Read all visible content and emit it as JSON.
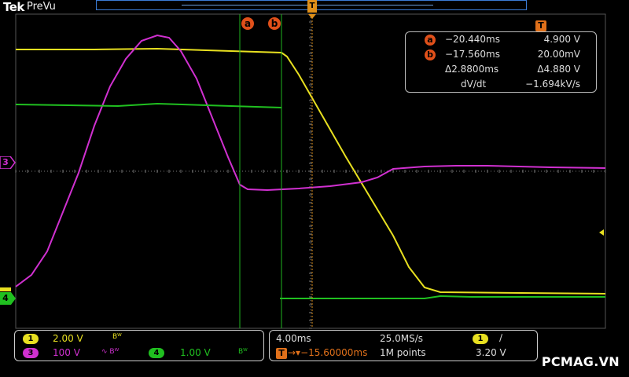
{
  "header": {
    "brand": "Tek",
    "mode": "PreVu"
  },
  "cursors": {
    "a_label": "a",
    "b_label": "b",
    "trigger_label": "T"
  },
  "readout": {
    "rows": [
      {
        "badge": "a",
        "time": "−20.440ms",
        "value": "4.900 V"
      },
      {
        "badge": "b",
        "time": "−17.560ms",
        "value": "20.00mV"
      },
      {
        "badge": "",
        "time": "Δ2.8800ms",
        "value": "Δ4.880 V"
      },
      {
        "badge": "",
        "time": "dV/dt",
        "value": "−1.694kV/s"
      }
    ]
  },
  "channel_markers": {
    "ch3": "3",
    "ch4": "4"
  },
  "bottom": {
    "ch1": {
      "num": "1",
      "scale": "2.00 V",
      "bw": "Bᵂ"
    },
    "ch3": {
      "num": "3",
      "scale": "100 V",
      "bw": "∿ Bᵂ"
    },
    "ch4": {
      "num": "4",
      "scale": "1.00 V",
      "bw": "Bᵂ"
    },
    "timebase": "4.00ms",
    "sample_rate": "25.0MS/s",
    "trigger_pos": "→▾−15.60000ms",
    "record_length": "1M points",
    "trigger_source": "1",
    "trigger_slope": "∕",
    "trigger_level": "3.20 V"
  },
  "watermark": "PCMAG.VN",
  "colors": {
    "ch1": "#e8e020",
    "ch3": "#d030d0",
    "ch4": "#20c020",
    "cursor": "#1fb41f",
    "grid": "#4a4a4a"
  }
}
